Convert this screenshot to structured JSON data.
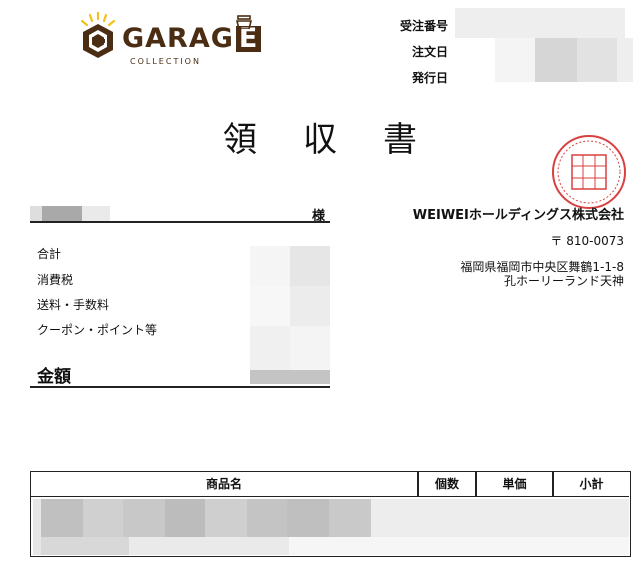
{
  "logo": {
    "word_main": "GARAG",
    "word_end": "E",
    "subtitle": "COLLECTION"
  },
  "header": {
    "order_number_label": "受注番号",
    "order_date_label": "注文日",
    "issue_date_label": "発行日"
  },
  "title": "領収書",
  "customer": {
    "honorific": "様"
  },
  "company": {
    "name": "WEIWEIホールディングス株式会社",
    "postal": "〒 810-0073",
    "address_line1": "福岡県福岡市中央区舞鶴1-1-8",
    "address_line2": "孔ホーリーランド天神"
  },
  "summary": {
    "subtotal_label": "合計",
    "tax_label": "消費税",
    "shipping_label": "送料・手数料",
    "coupon_label": "クーポン・ポイント等",
    "total_label": "金額"
  },
  "table": {
    "headers": [
      "商品名",
      "個数",
      "単価",
      "小計"
    ]
  },
  "colors": {
    "logo_brown": "#4a2d12",
    "logo_yellow": "#f2c21a",
    "seal_red": "#d94040"
  }
}
